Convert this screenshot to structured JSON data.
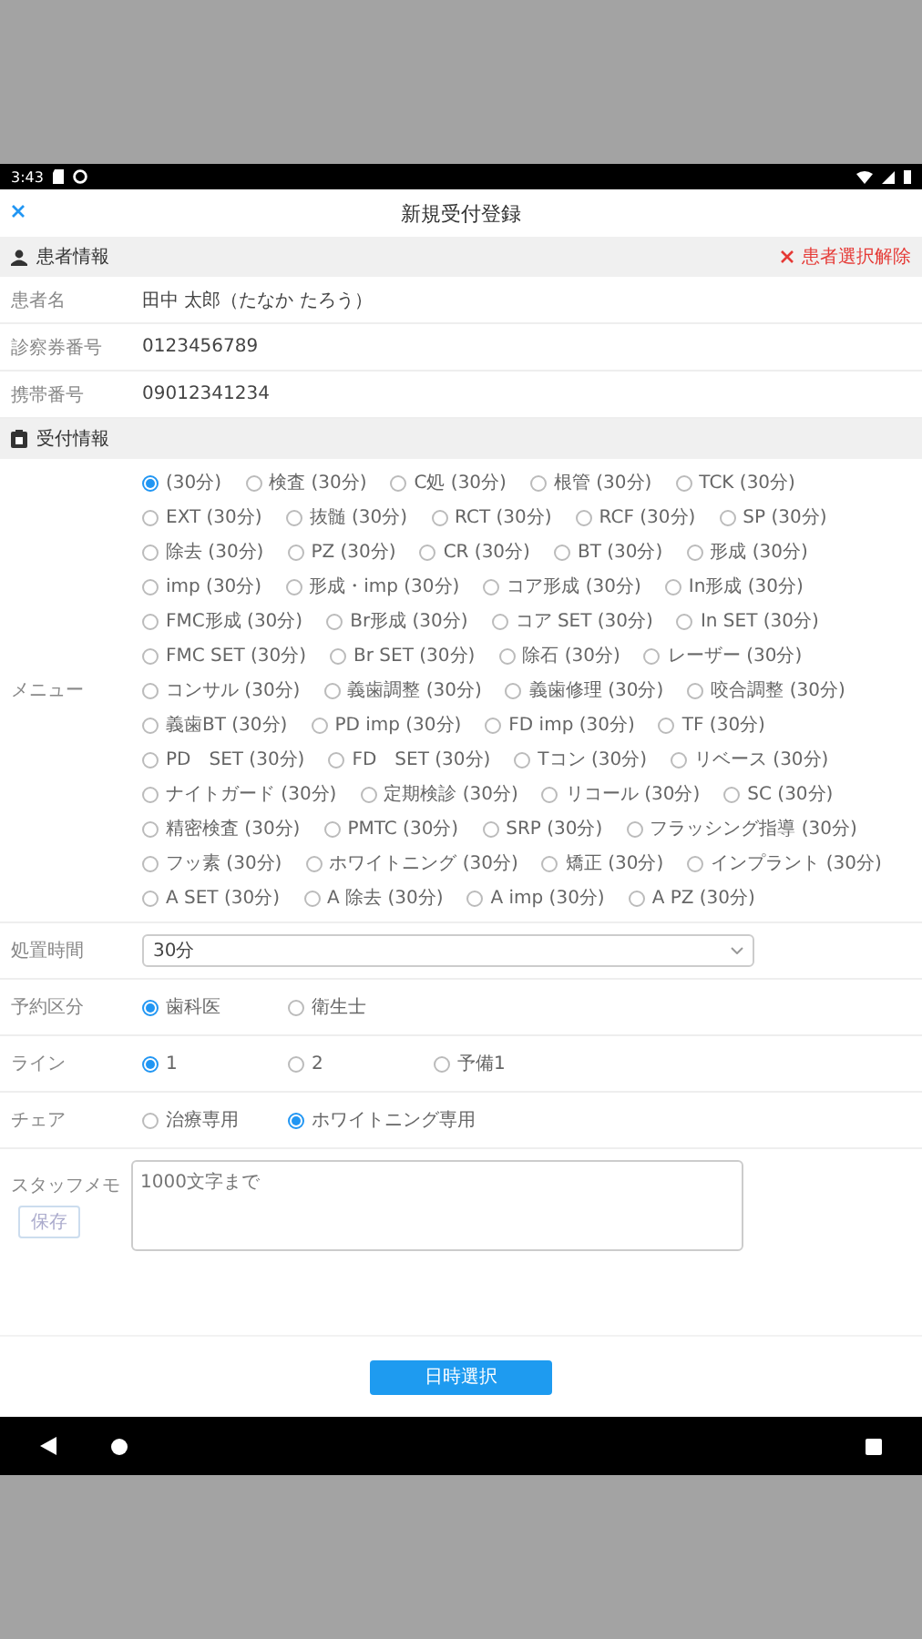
{
  "status_bar": {
    "time": "3:43"
  },
  "header": {
    "title": "新規受付登録"
  },
  "patient_section": {
    "title": "患者情報",
    "action": "患者選択解除",
    "fields": [
      {
        "label": "患者名",
        "value": "田中 太郎（たなか たろう）"
      },
      {
        "label": "診察券番号",
        "value": "0123456789"
      },
      {
        "label": "携帯番号",
        "value": "09012341234"
      }
    ]
  },
  "reception_section": {
    "title": "受付情報"
  },
  "menu": {
    "label": "メニュー",
    "options": [
      {
        "label": "(30分)",
        "selected": true
      },
      {
        "label": "検査 (30分)",
        "selected": false
      },
      {
        "label": "C処 (30分)",
        "selected": false
      },
      {
        "label": "根管 (30分)",
        "selected": false
      },
      {
        "label": "TCK (30分)",
        "selected": false
      },
      {
        "label": "EXT (30分)",
        "selected": false
      },
      {
        "label": "抜髄 (30分)",
        "selected": false
      },
      {
        "label": "RCT (30分)",
        "selected": false
      },
      {
        "label": "RCF (30分)",
        "selected": false
      },
      {
        "label": "SP (30分)",
        "selected": false
      },
      {
        "label": "除去 (30分)",
        "selected": false
      },
      {
        "label": "PZ (30分)",
        "selected": false
      },
      {
        "label": "CR (30分)",
        "selected": false
      },
      {
        "label": "BT (30分)",
        "selected": false
      },
      {
        "label": "形成 (30分)",
        "selected": false
      },
      {
        "label": "imp (30分)",
        "selected": false
      },
      {
        "label": "形成・imp (30分)",
        "selected": false
      },
      {
        "label": "コア形成 (30分)",
        "selected": false
      },
      {
        "label": "In形成 (30分)",
        "selected": false
      },
      {
        "label": "FMC形成 (30分)",
        "selected": false
      },
      {
        "label": "Br形成 (30分)",
        "selected": false
      },
      {
        "label": "コア SET (30分)",
        "selected": false
      },
      {
        "label": "In SET (30分)",
        "selected": false
      },
      {
        "label": "FMC SET (30分)",
        "selected": false
      },
      {
        "label": "Br SET (30分)",
        "selected": false
      },
      {
        "label": "除石 (30分)",
        "selected": false
      },
      {
        "label": "レーザー (30分)",
        "selected": false
      },
      {
        "label": "コンサル (30分)",
        "selected": false
      },
      {
        "label": "義歯調整 (30分)",
        "selected": false
      },
      {
        "label": "義歯修理 (30分)",
        "selected": false
      },
      {
        "label": "咬合調整 (30分)",
        "selected": false
      },
      {
        "label": "義歯BT (30分)",
        "selected": false
      },
      {
        "label": "PD imp (30分)",
        "selected": false
      },
      {
        "label": "FD imp (30分)",
        "selected": false
      },
      {
        "label": "TF (30分)",
        "selected": false
      },
      {
        "label": "PD　SET (30分)",
        "selected": false
      },
      {
        "label": "FD　SET (30分)",
        "selected": false
      },
      {
        "label": "Tコン (30分)",
        "selected": false
      },
      {
        "label": "リベース (30分)",
        "selected": false
      },
      {
        "label": "ナイトガード (30分)",
        "selected": false
      },
      {
        "label": "定期検診 (30分)",
        "selected": false
      },
      {
        "label": "リコール (30分)",
        "selected": false
      },
      {
        "label": "SC (30分)",
        "selected": false
      },
      {
        "label": "精密検査 (30分)",
        "selected": false
      },
      {
        "label": "PMTC (30分)",
        "selected": false
      },
      {
        "label": "SRP (30分)",
        "selected": false
      },
      {
        "label": "フラッシング指導 (30分)",
        "selected": false
      },
      {
        "label": "フッ素 (30分)",
        "selected": false
      },
      {
        "label": "ホワイトニング (30分)",
        "selected": false
      },
      {
        "label": "矯正 (30分)",
        "selected": false
      },
      {
        "label": "インプラント (30分)",
        "selected": false
      },
      {
        "label": "A SET (30分)",
        "selected": false
      },
      {
        "label": "A 除去 (30分)",
        "selected": false
      },
      {
        "label": "A imp (30分)",
        "selected": false
      },
      {
        "label": "A PZ (30分)",
        "selected": false
      }
    ]
  },
  "treatment_time": {
    "label": "処置時間",
    "value": "30分"
  },
  "radio_groups": [
    {
      "label": "予約区分",
      "options": [
        {
          "label": "歯科医",
          "selected": true
        },
        {
          "label": "衛生士",
          "selected": false
        }
      ]
    },
    {
      "label": "ライン",
      "options": [
        {
          "label": "1",
          "selected": true
        },
        {
          "label": "2",
          "selected": false
        },
        {
          "label": "予備1",
          "selected": false
        }
      ]
    },
    {
      "label": "チェア",
      "options": [
        {
          "label": "治療専用",
          "selected": false
        },
        {
          "label": "ホワイトニング専用",
          "selected": true
        }
      ]
    }
  ],
  "staff_memo": {
    "label": "スタッフメモ",
    "placeholder": "1000文字まで",
    "button": "保存"
  },
  "submit_button": "日時選択"
}
